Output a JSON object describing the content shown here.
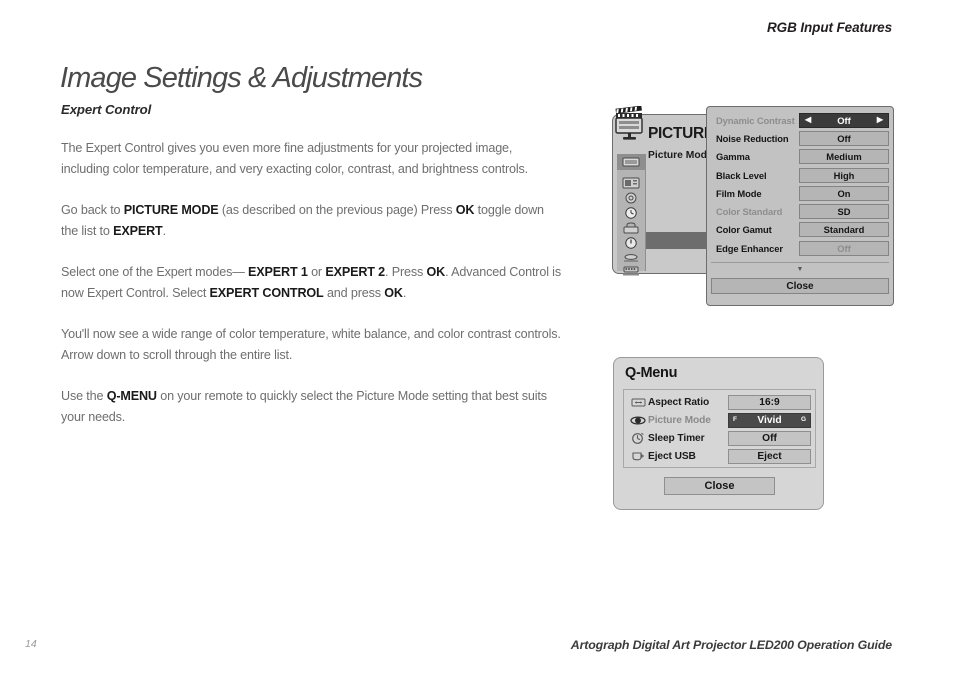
{
  "header": {
    "running_head": "RGB Input Features",
    "page_title": "Image Settings & Adjustments"
  },
  "content": {
    "section_heading": "Expert Control",
    "paragraphs": [
      "The Expert Control gives you even more fine adjustments for your projected image, including color temperature, and very exacting color, contrast, and brightness controls.",
      "Go back to PICTURE MODE (as described on the previous page) Press OK toggle down the list to EXPERT.",
      "Select one of the Expert modes— EXPERT 1 or EXPERT 2. Press OK. Advanced Control is now Expert Control. Select EXPERT CONTROL and press OK.",
      "You'll now see a wide range of color temperature, white balance, and color contrast controls. Arrow down to scroll through the entire list.",
      "Use the Q-MENU on your remote to quickly select the Picture Mode setting that best suits your needs."
    ],
    "p1_a": "The Expert Control gives you even more fine adjustments for your projected image, including color temperature, and very exacting color, contrast, and brightness controls.",
    "p2_a": "Go back to ",
    "p2_b1": "PICTURE MODE",
    "p2_c": " (as described on the previous page) Press ",
    "p2_b2": "OK",
    "p2_d": " toggle down the list to ",
    "p2_b3": "EXPERT",
    "p2_e": ".",
    "p3_a": "Select one of the Expert modes— ",
    "p3_b1": "EXPERT 1",
    "p3_c": " or ",
    "p3_b2": "EXPERT 2",
    "p3_d": ". Press ",
    "p3_b3": "OK",
    "p3_e": ". Advanced Control is now Expert Control. Select ",
    "p3_b4": "EXPERT CONTROL",
    "p3_f": " and press ",
    "p3_b5": "OK",
    "p3_g": ".",
    "p4_a": "You'll now see a wide range of color temperature, white balance, and color contrast controls. Arrow down to scroll through the entire list.",
    "p5_a": "Use the ",
    "p5_b1": "Q-MENU",
    "p5_c": " on your remote to quickly select the Picture Mode setting that best suits your needs."
  },
  "osd_picture": {
    "title": "PICTURE",
    "subitem": "Picture Mod",
    "sidebar_icons": [
      "monitor-picture-icon",
      "screen-audio-icon",
      "clock-circle-icon",
      "timer-icon",
      "lock-setup-icon",
      "power-option-icon",
      "usb-connection-icon",
      "input-list-icon"
    ],
    "rows": [
      {
        "label": "Dynamic Contrast",
        "value": "Off",
        "selected": true,
        "label_dim": true,
        "value_dim": false,
        "arrows": true
      },
      {
        "label": "Noise Reduction",
        "value": "Off",
        "selected": false,
        "label_dim": false,
        "value_dim": false,
        "arrows": false
      },
      {
        "label": "Gamma",
        "value": "Medium",
        "selected": false,
        "label_dim": false,
        "value_dim": false,
        "arrows": false
      },
      {
        "label": "Black Level",
        "value": "High",
        "selected": false,
        "label_dim": false,
        "value_dim": false,
        "arrows": false
      },
      {
        "label": "Film Mode",
        "value": "On",
        "selected": false,
        "label_dim": false,
        "value_dim": false,
        "arrows": false
      },
      {
        "label": "Color Standard",
        "value": "SD",
        "selected": false,
        "label_dim": true,
        "value_dim": false,
        "arrows": false
      },
      {
        "label": "Color Gamut",
        "value": "Standard",
        "selected": false,
        "label_dim": false,
        "value_dim": false,
        "arrows": false
      },
      {
        "label": "Edge Enhancer",
        "value": "Off",
        "selected": false,
        "label_dim": false,
        "value_dim": true,
        "arrows": false
      }
    ],
    "scroll_glyph": "▼",
    "close_label": "Close",
    "arrow_left": "◀",
    "arrow_right": "▶"
  },
  "qmenu": {
    "title": "Q-Menu",
    "rows": [
      {
        "icon": "aspect-ratio-icon",
        "label": "Aspect Ratio",
        "value": "16:9",
        "selected": false,
        "label_dim": false
      },
      {
        "icon": "eye-picture-mode-icon",
        "label": "Picture Mode",
        "value": "Vivid",
        "selected": true,
        "label_dim": true
      },
      {
        "icon": "sleep-timer-icon",
        "label": "Sleep Timer",
        "value": "Off",
        "selected": false,
        "label_dim": false
      },
      {
        "icon": "eject-usb-icon",
        "label": "Eject USB",
        "value": "Eject",
        "selected": false,
        "label_dim": false
      }
    ],
    "marker_left": "F",
    "marker_right": "G",
    "close_label": "Close"
  },
  "footer": {
    "folio": "14",
    "title": "Artograph Digital Art Projector LED200 Operation Guide"
  },
  "colors": {
    "osd_panel": "#c2c2c2",
    "osd_value": "#b5b5b5",
    "osd_selected": "#3b3b3b",
    "qmenu_panel": "#d6d6d6",
    "qmenu_selected": "#4a4a4a",
    "body_text": "#6e6e6e",
    "heading_text": "#2b2b2b"
  }
}
